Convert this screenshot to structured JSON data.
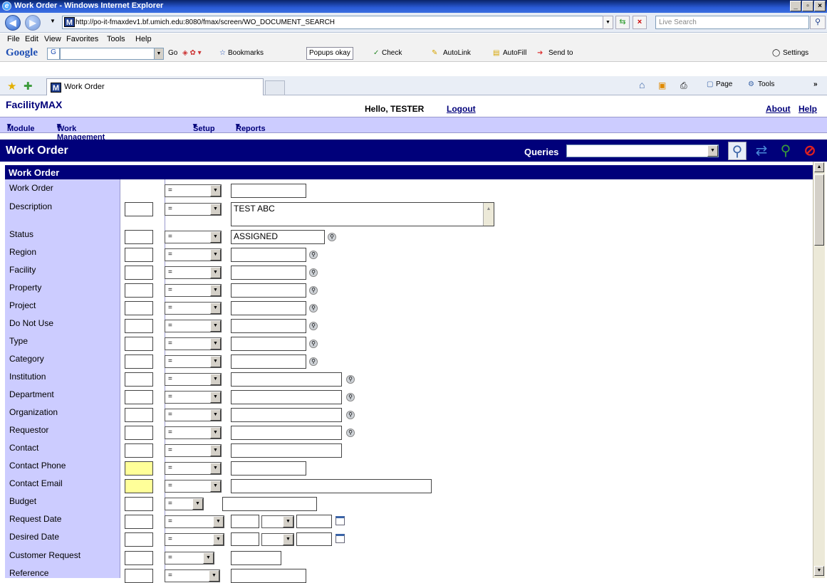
{
  "window": {
    "title": "Work Order - Windows Internet Explorer"
  },
  "browser": {
    "url": "http://po-it-fmaxdev1.bf.umich.edu:8080/fmax/screen/WO_DOCUMENT_SEARCH",
    "search_placeholder": "Live Search",
    "menu": [
      "File",
      "Edit",
      "View",
      "Favorites",
      "Tools",
      "Help"
    ],
    "google": {
      "logo": "Google",
      "go": "Go",
      "bookmarks": "Bookmarks",
      "popups": "Popups okay",
      "check": "Check",
      "autolink": "AutoLink",
      "autofill": "AutoFill",
      "sendto": "Send to",
      "settings": "Settings"
    },
    "tab_title": "Work Order",
    "command_bar": {
      "page": "Page",
      "tools": "Tools"
    }
  },
  "app": {
    "brand": "FacilityMAX",
    "greeting": "Hello, TESTER",
    "logout": "Logout",
    "about": "About",
    "help": "Help",
    "nav": [
      "Module",
      "Work Management",
      "Setup",
      "Reports"
    ],
    "page_title": "Work Order",
    "queries_label": "Queries",
    "section_title": "Work Order"
  },
  "form": {
    "operator_default": "=",
    "fields": [
      {
        "label": "Work Order",
        "value": ""
      },
      {
        "label": "Description",
        "value": "TEST ABC"
      },
      {
        "label": "Status",
        "value": "ASSIGNED"
      },
      {
        "label": "Region",
        "value": ""
      },
      {
        "label": "Facility",
        "value": ""
      },
      {
        "label": "Property",
        "value": ""
      },
      {
        "label": "Project",
        "value": ""
      },
      {
        "label": "Do Not Use",
        "value": ""
      },
      {
        "label": "Type",
        "value": ""
      },
      {
        "label": "Category",
        "value": ""
      },
      {
        "label": "Institution",
        "value": ""
      },
      {
        "label": "Department",
        "value": ""
      },
      {
        "label": "Organization",
        "value": ""
      },
      {
        "label": "Requestor",
        "value": ""
      },
      {
        "label": "Contact",
        "value": ""
      },
      {
        "label": "Contact Phone",
        "value": ""
      },
      {
        "label": "Contact Email",
        "value": ""
      },
      {
        "label": "Budget",
        "value": ""
      },
      {
        "label": "Request Date",
        "value": ""
      },
      {
        "label": "Desired Date",
        "value": ""
      },
      {
        "label": "Customer Request",
        "value": ""
      },
      {
        "label": "Reference",
        "value": ""
      }
    ]
  },
  "colors": {
    "brand_navy": "#00007a",
    "label_column": "#ccccff",
    "required_field": "#ffff99"
  }
}
